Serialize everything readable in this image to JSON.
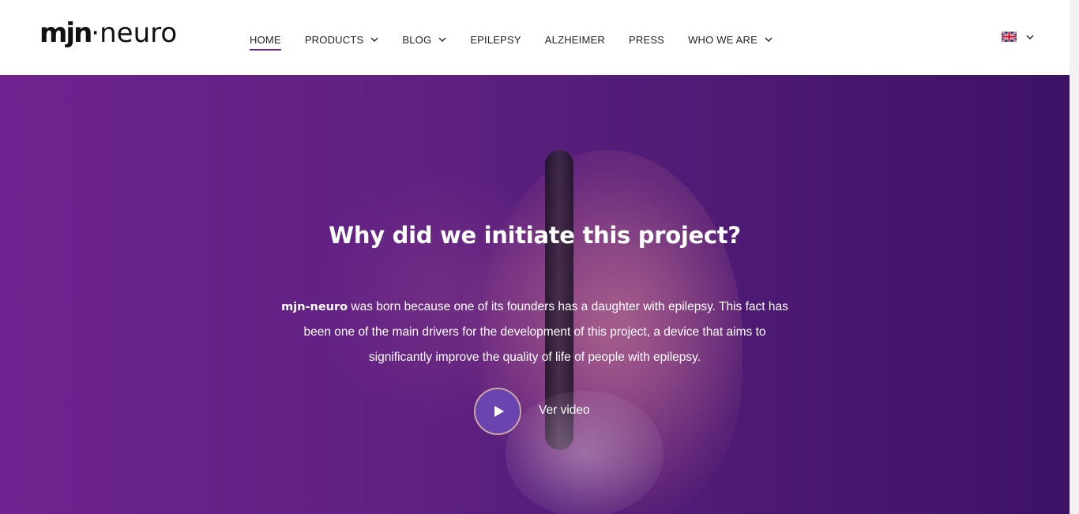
{
  "brand": {
    "logo_part1": "mjn",
    "logo_dot": "·",
    "logo_part2": "neuro"
  },
  "nav": {
    "home": "HOME",
    "products": "PRODUCTS",
    "blog": "BLOG",
    "epilepsy": "EPILEPSY",
    "alzheimer": "ALZHEIMER",
    "press": "PRESS",
    "who_we_are": "WHO WE ARE",
    "active": "HOME"
  },
  "language": {
    "flag_icon": "uk-flag-icon"
  },
  "hero": {
    "title": "Why did we initiate this project?",
    "text_bold": "mjn-neuro",
    "text_rest": " was born because one of its founders has a daughter with epilepsy. This fact has been one of the main drivers for the development of this project, a device that aims to significantly improve the quality of life of people with epilepsy.",
    "video_label": "Ver video"
  },
  "colors": {
    "accent": "#6b2a8a",
    "hero_purple": "#612183",
    "play_button": "#6a45b0"
  }
}
